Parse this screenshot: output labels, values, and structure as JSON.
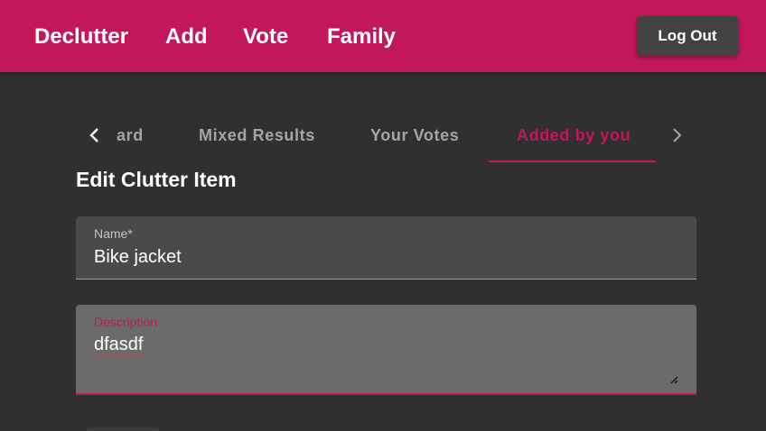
{
  "nav": {
    "links": [
      "Declutter",
      "Add",
      "Vote",
      "Family"
    ],
    "logout_label": "Log Out"
  },
  "tabs": {
    "items": [
      "ard",
      "Mixed Results",
      "Your Votes",
      "Added by you"
    ],
    "active_index": 3,
    "prev_icon": "chevron-left-icon",
    "next_icon": "chevron-right-icon"
  },
  "form": {
    "title": "Edit Clutter Item",
    "name_label": "Name*",
    "name_value": "Bike jacket",
    "description_label": "Description",
    "description_value": "dfasdf"
  },
  "colors": {
    "primary": "#c2185b",
    "background": "#303030",
    "button": "#424242"
  }
}
